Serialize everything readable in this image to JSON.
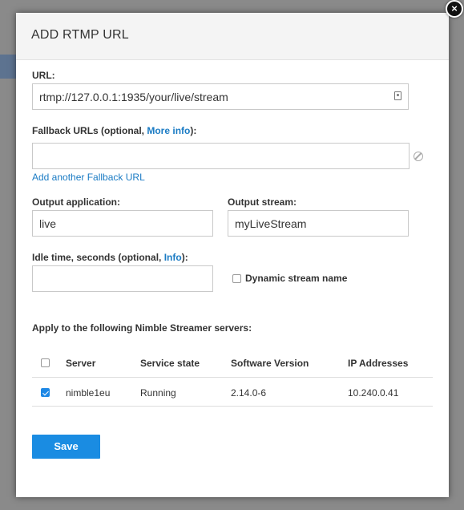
{
  "dialog": {
    "title": "ADD RTMP URL",
    "close_glyph": "×"
  },
  "url": {
    "label": "URL:",
    "value": "rtmp://127.0.0.1:1935/your/live/stream"
  },
  "fallback": {
    "label_prefix": "Fallback URLs (optional, ",
    "more_info": "More info",
    "label_suffix": "):",
    "value": "",
    "add_link": "Add another Fallback URL"
  },
  "output_application": {
    "label": "Output application:",
    "value": "live"
  },
  "output_stream": {
    "label": "Output stream:",
    "value": "myLiveStream"
  },
  "idle_time": {
    "label_prefix": "Idle time, seconds (optional, ",
    "info": "Info",
    "label_suffix": "):",
    "value": ""
  },
  "dynamic_stream": {
    "label": "Dynamic stream name",
    "checked": false
  },
  "servers": {
    "heading": "Apply to the following Nimble Streamer servers:",
    "columns": [
      "Server",
      "Service state",
      "Software Version",
      "IP Addresses"
    ],
    "rows": [
      {
        "checked": true,
        "server": "nimble1eu",
        "state": "Running",
        "version": "2.14.0-6",
        "ip": "10.240.0.41"
      }
    ]
  },
  "save_label": "Save",
  "colors": {
    "accent": "#1a8ce2",
    "link": "#1a7bc4"
  }
}
